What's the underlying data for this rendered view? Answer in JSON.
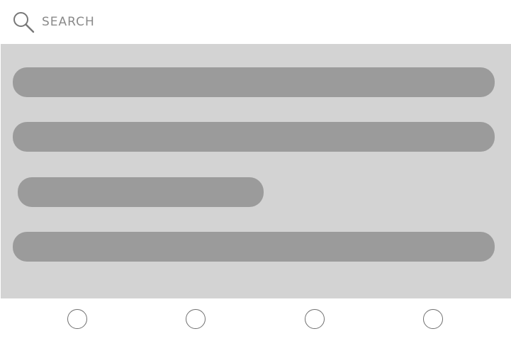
{
  "search": {
    "placeholder": "SEARCH",
    "value": "",
    "icon": "search-icon"
  },
  "content": {
    "placeholder_bar_count": 4
  },
  "bottom_nav": {
    "items": [
      {
        "icon": "circle-icon"
      },
      {
        "icon": "circle-icon"
      },
      {
        "icon": "circle-icon"
      },
      {
        "icon": "circle-icon"
      }
    ]
  },
  "colors": {
    "panel_background": "#d3d3d3",
    "placeholder_bar": "#9b9b9b",
    "icon_stroke": "#6f6f6f",
    "placeholder_text": "#8a8a8a"
  }
}
